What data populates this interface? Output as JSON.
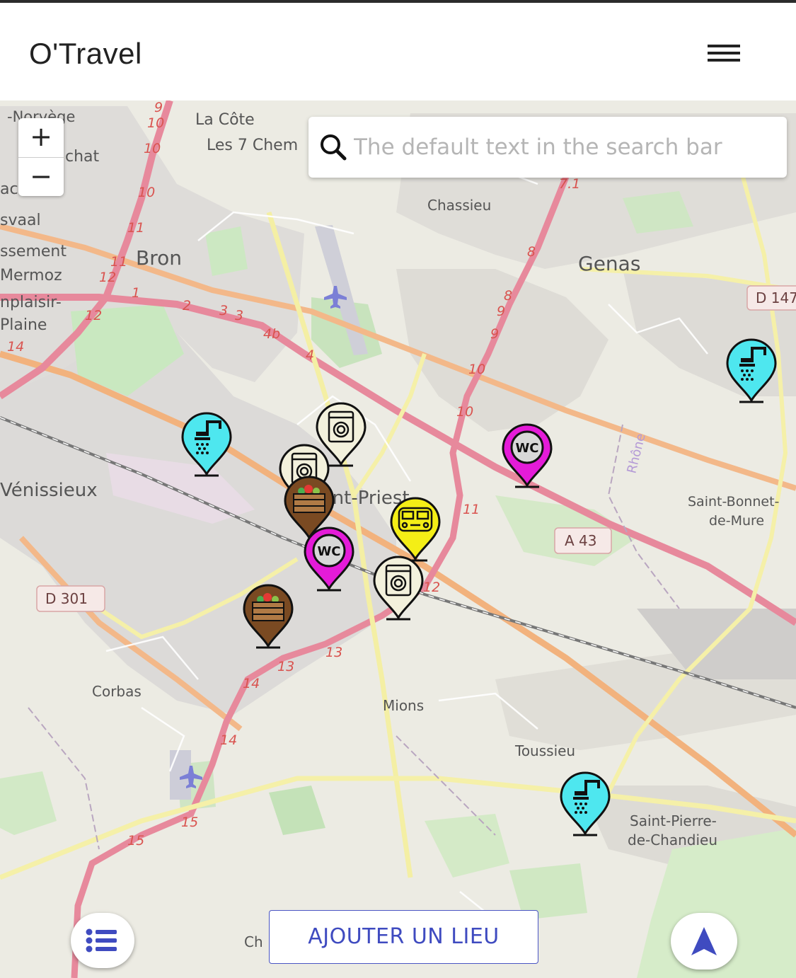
{
  "app": {
    "title": "O'Travel"
  },
  "header": {
    "menu_icon": "hamburger-menu-icon"
  },
  "search": {
    "placeholder": "The default text in the search bar",
    "icon": "search-icon"
  },
  "zoom": {
    "in_label": "+",
    "out_label": "−"
  },
  "map": {
    "place_labels": [
      "-Norvège",
      "La Côte",
      "Les 7 Chem",
      "chat",
      "ache",
      "svaal",
      "ssement",
      "Mermoz",
      "nplaisir-",
      "Plaine",
      "Bron",
      "Chassieu",
      "Genas",
      "Vénissieux",
      "Saint-Priest",
      "Saint-Bonnet-",
      "de-Mure",
      "Corbas",
      "Mions",
      "Toussieu",
      "Saint-Pierre-",
      "de-Chandieu",
      "Rhône",
      "Ch"
    ],
    "road_shields": [
      "D 301",
      "A 43",
      "D 147"
    ],
    "road_numbers": [
      "9",
      "10",
      "10",
      "10",
      "11",
      "11",
      "12",
      "12",
      "1",
      "2",
      "3",
      "3",
      "4b",
      "4",
      "14",
      "7.1",
      "8",
      "8",
      "9",
      "9",
      "10",
      "10",
      "11",
      "12",
      "13",
      "13",
      "14",
      "14",
      "15",
      "15"
    ],
    "airport_icon": "airplane-icon",
    "marker_colors": {
      "shower": "#4ee7ef",
      "laundry": "#f3f1dc",
      "wc": "#e41bd8",
      "market": "#7a4a22",
      "van": "#f4ee16"
    }
  },
  "markers": [
    {
      "type": "shower",
      "icon": "shower-icon"
    },
    {
      "type": "laundry",
      "icon": "washing-machine-icon"
    },
    {
      "type": "laundry",
      "icon": "washing-machine-icon"
    },
    {
      "type": "market",
      "icon": "vegetable-crate-icon"
    },
    {
      "type": "wc",
      "icon": "wc-icon",
      "label": "WC"
    },
    {
      "type": "wc",
      "icon": "wc-icon",
      "label": "WC"
    },
    {
      "type": "van",
      "icon": "camper-van-icon"
    },
    {
      "type": "laundry",
      "icon": "washing-machine-icon"
    },
    {
      "type": "market",
      "icon": "vegetable-crate-icon"
    },
    {
      "type": "shower",
      "icon": "shower-icon"
    },
    {
      "type": "shower",
      "icon": "shower-icon"
    }
  ],
  "footer": {
    "add_place_label": "AJOUTER UN LIEU",
    "list_icon": "list-icon",
    "navigation_icon": "navigation-arrow-icon"
  }
}
